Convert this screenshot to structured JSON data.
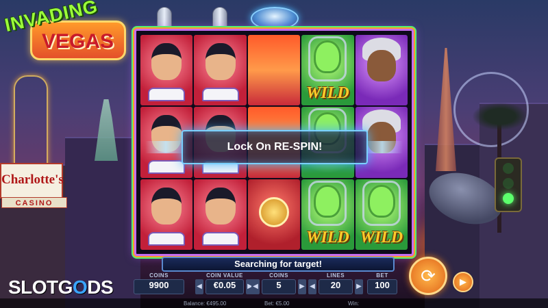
{
  "game": {
    "logo_line1": "INVADING",
    "logo_line2": "VEGAS",
    "casino_sign": "Charlotte's",
    "casino_sub": "CASINO"
  },
  "reels": {
    "rows": [
      [
        "elvis",
        "elvis",
        "beam",
        "alien-wild",
        "lady"
      ],
      [
        "elvis",
        "elvis",
        "beam",
        "alien",
        "lady"
      ],
      [
        "elvis",
        "elvis",
        "coin",
        "alien-wild",
        "alien-wild"
      ]
    ],
    "wild_label": "WILD"
  },
  "messages": {
    "lock": "Lock On RE-SPIN!",
    "status": "Searching for target!"
  },
  "controls": {
    "coins_label": "COINS",
    "coins_value": "9900",
    "coin_value_label": "COIN VALUE",
    "coin_value": "€0.05",
    "bet_coins_label": "COINS",
    "bet_coins_value": "5",
    "lines_label": "LINES",
    "lines_value": "20",
    "bet_label": "BET",
    "bet_value": "100",
    "arrow_left": "◀",
    "arrow_right": "▶",
    "spin_icon": "⟳",
    "auto_icon": "▶"
  },
  "footer": {
    "balance": "Balance: €495.00",
    "bet": "Bet: €5.00",
    "win": "Win:"
  },
  "watermark": {
    "text_a": "SLOTG",
    "text_o": "O",
    "text_b": "DS"
  }
}
